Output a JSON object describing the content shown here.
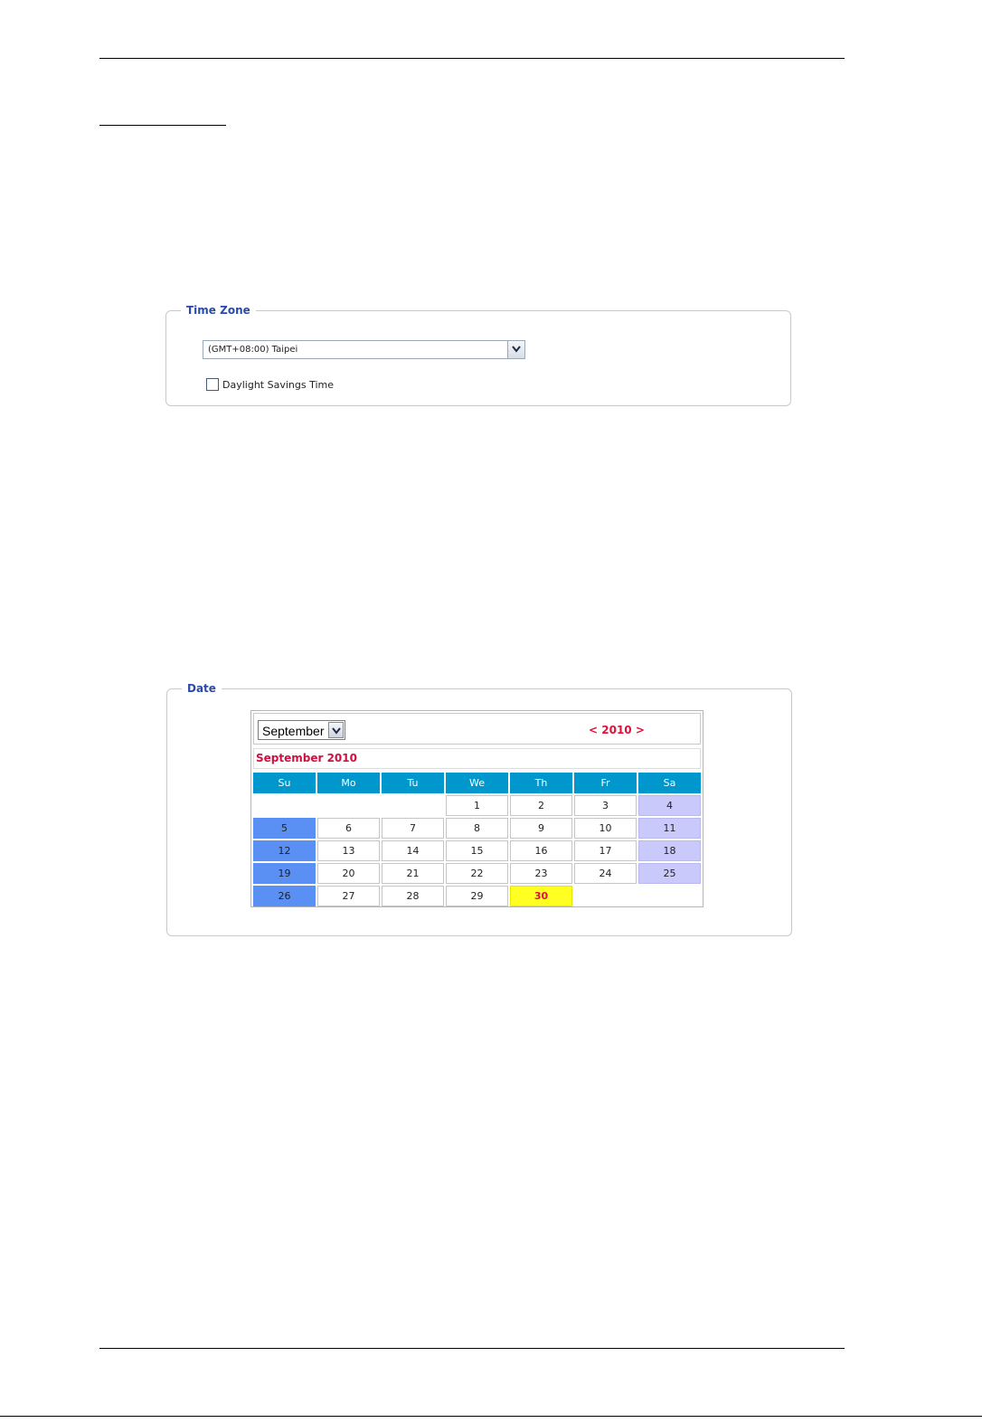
{
  "timezone": {
    "legend": "Time Zone",
    "selected": "(GMT+08:00) Taipei",
    "dst_label": "Daylight Savings Time",
    "dst_checked": false
  },
  "date": {
    "legend": "Date",
    "month_selected": "September",
    "year_nav": {
      "prev": "<",
      "year": "2010",
      "next": ">"
    },
    "title": "September 2010",
    "weekdays": [
      "Su",
      "Mo",
      "Tu",
      "We",
      "Th",
      "Fr",
      "Sa"
    ],
    "weeks": [
      [
        "",
        "",
        "",
        "1",
        "2",
        "3",
        "4"
      ],
      [
        "5",
        "6",
        "7",
        "8",
        "9",
        "10",
        "11"
      ],
      [
        "12",
        "13",
        "14",
        "15",
        "16",
        "17",
        "18"
      ],
      [
        "19",
        "20",
        "21",
        "22",
        "23",
        "24",
        "25"
      ],
      [
        "26",
        "27",
        "28",
        "29",
        "30",
        "",
        ""
      ]
    ],
    "today": "30"
  },
  "colors": {
    "legend": "#2a4aa8",
    "weekday_header": "#0097cc",
    "sunday": "#5a8ff4",
    "saturday": "#c9c9fb",
    "today_bg": "#ffff22",
    "accent_red": "#e0103a"
  }
}
